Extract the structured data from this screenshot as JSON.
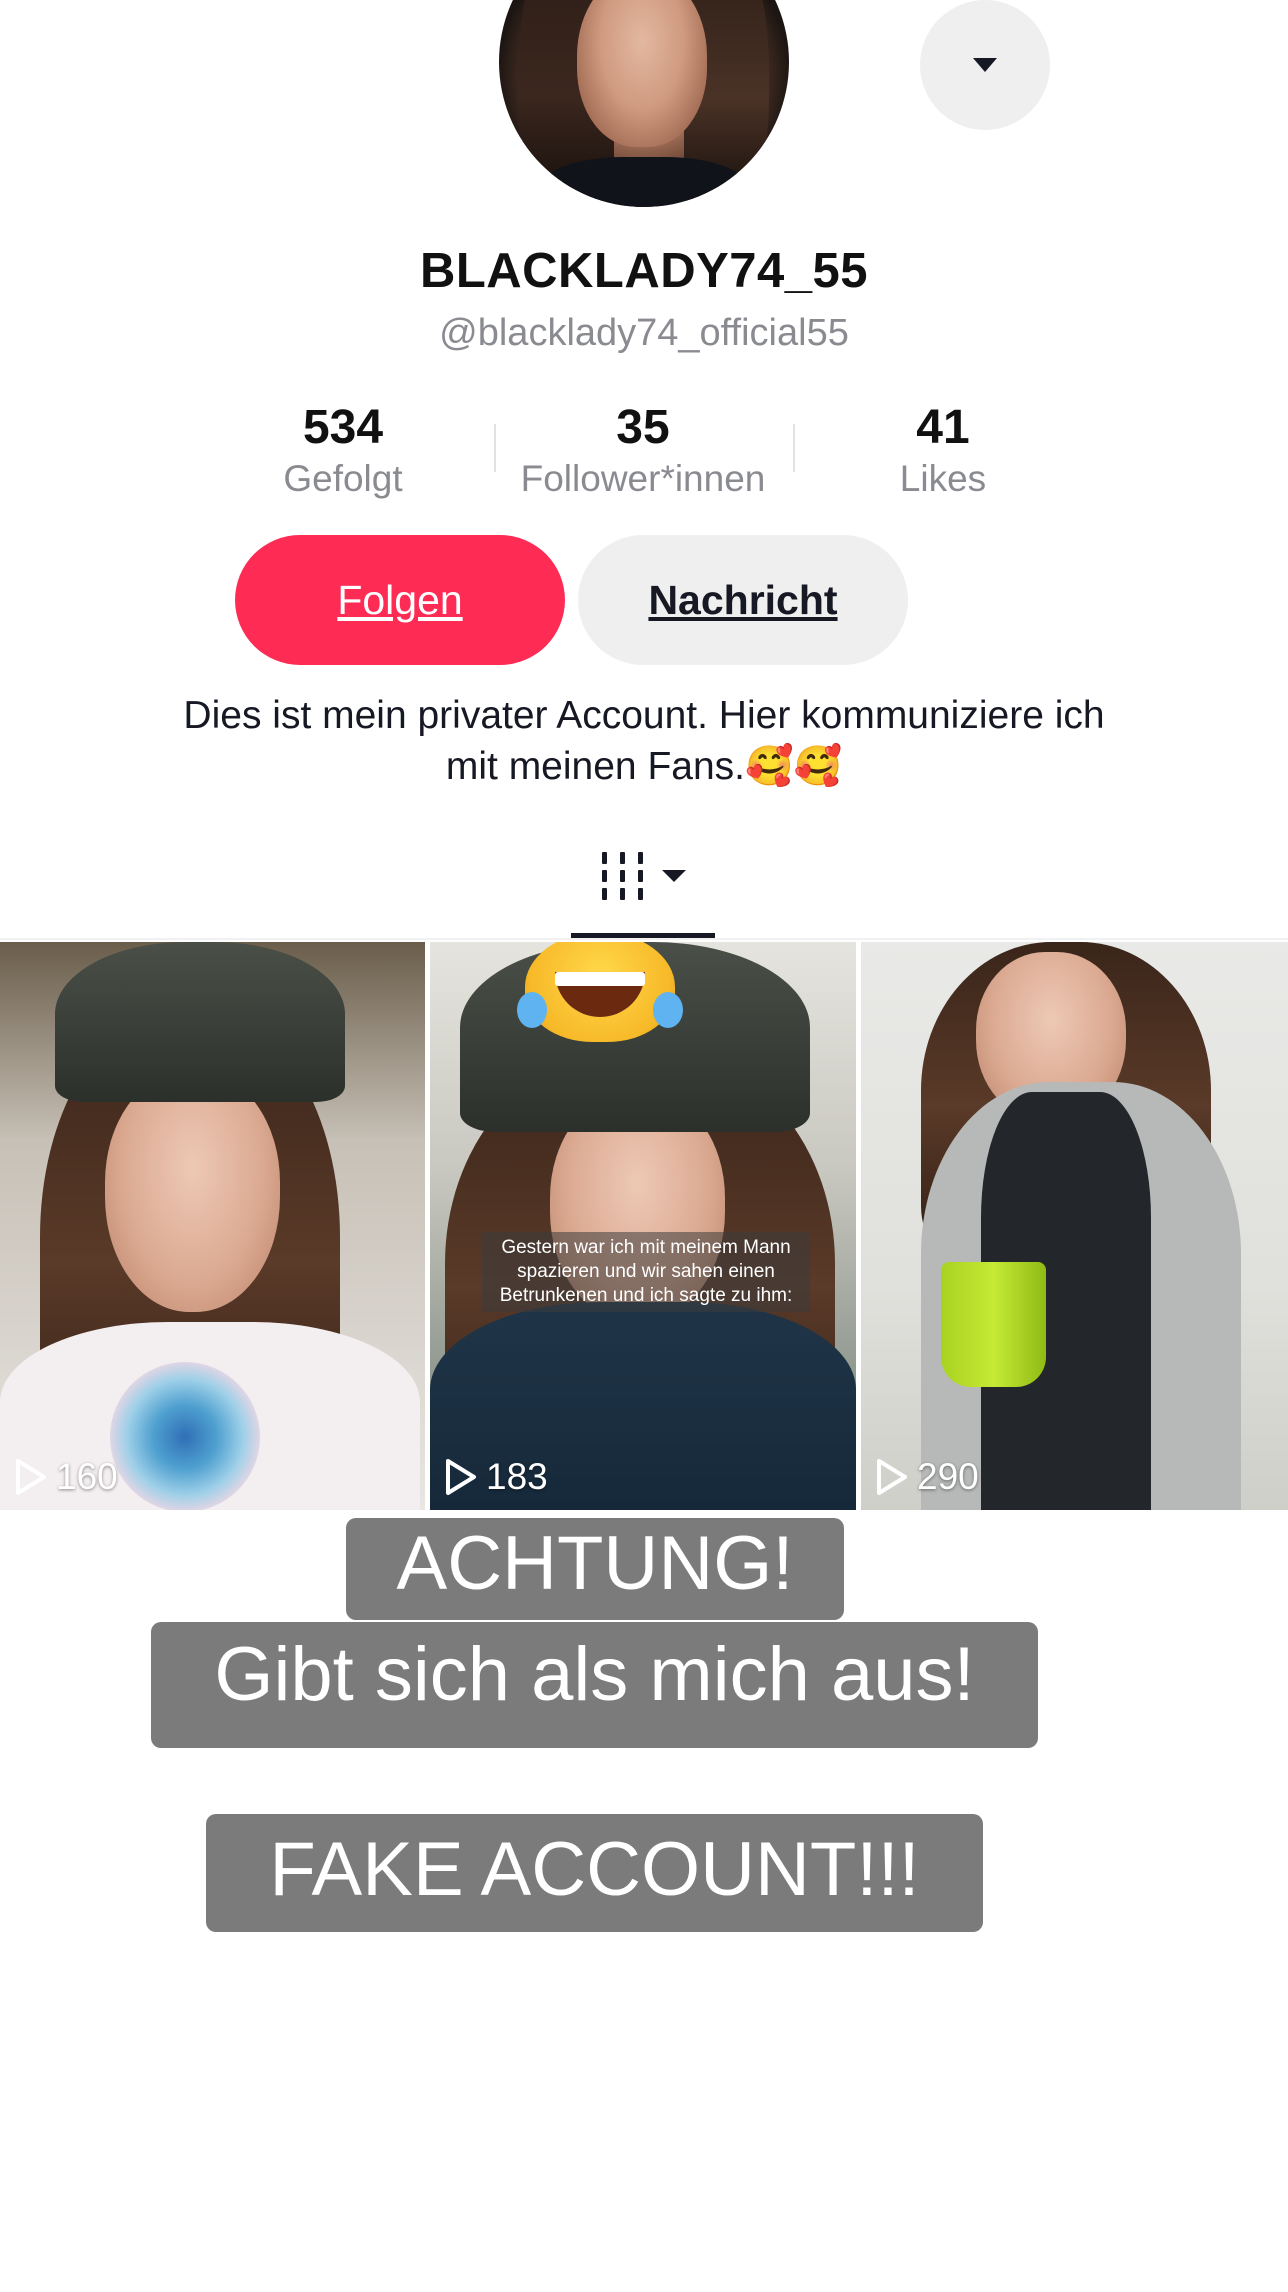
{
  "profile": {
    "display_name": "BLACKLADY74_55",
    "handle": "@blacklady74_official55",
    "bio_line1": "Dies ist mein privater Account. Hier kommuniziere ich",
    "bio_line2": "mit meinen Fans.",
    "bio_emoji": "🥰🥰"
  },
  "stats": [
    {
      "value": "534",
      "label": "Gefolgt"
    },
    {
      "value": "35",
      "label": "Follower*innen"
    },
    {
      "value": "41",
      "label": "Likes"
    }
  ],
  "actions": {
    "follow_label": "Folgen",
    "message_label": "Nachricht",
    "more_icon": "caret-down-icon"
  },
  "tabs": {
    "active_icon": "videos-grid-icon"
  },
  "videos": [
    {
      "views": "160"
    },
    {
      "views": "183",
      "caption": "Gestern war ich mit meinem Mann spazieren und wir sahen einen Betrunkenen und ich sagte zu ihm:",
      "emoji": "laughing-tears-emoji"
    },
    {
      "views": "290"
    }
  ],
  "overlay": {
    "line1": "ACHTUNG!",
    "line2": "Gibt sich als mich aus!",
    "line3": "FAKE ACCOUNT!!!"
  },
  "colors": {
    "follow_button": "#fe2c55",
    "secondary_button": "#efeff0",
    "banner": "#7b7b7b"
  }
}
